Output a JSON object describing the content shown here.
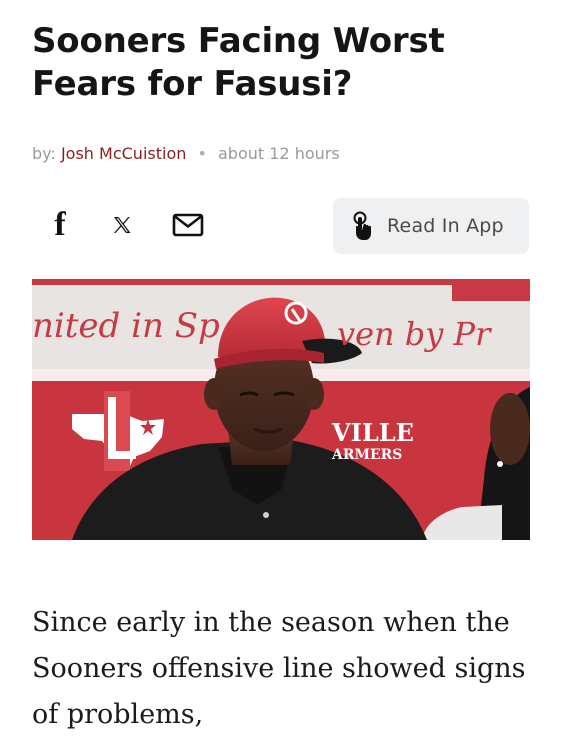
{
  "article": {
    "title": "Sooners Facing Worst Fears for Fasusi?",
    "byline": {
      "prefix": "by:",
      "author": "Josh McCuistion",
      "separator": "•",
      "time": "about 12 hours"
    },
    "share": {
      "facebook_icon": "facebook-icon",
      "x_icon": "x-icon",
      "mail_icon": "mail-icon"
    },
    "read_in_app": {
      "label": "Read In App",
      "icon": "tap-hand-icon"
    },
    "photo": {
      "banner_text_left": "nited in Sp",
      "banner_text_right": "ven by Pr",
      "sign_line1": "VILLE",
      "sign_line2": "ARMERS",
      "cap_logo": "OU"
    },
    "body": "Since early in the season when the Sooners offensive line showed signs of problems,"
  },
  "colors": {
    "author": "#8b1f1f",
    "meta": "#9a9a9a",
    "button_bg": "#eef0f2",
    "crimson": "#c8353f"
  }
}
